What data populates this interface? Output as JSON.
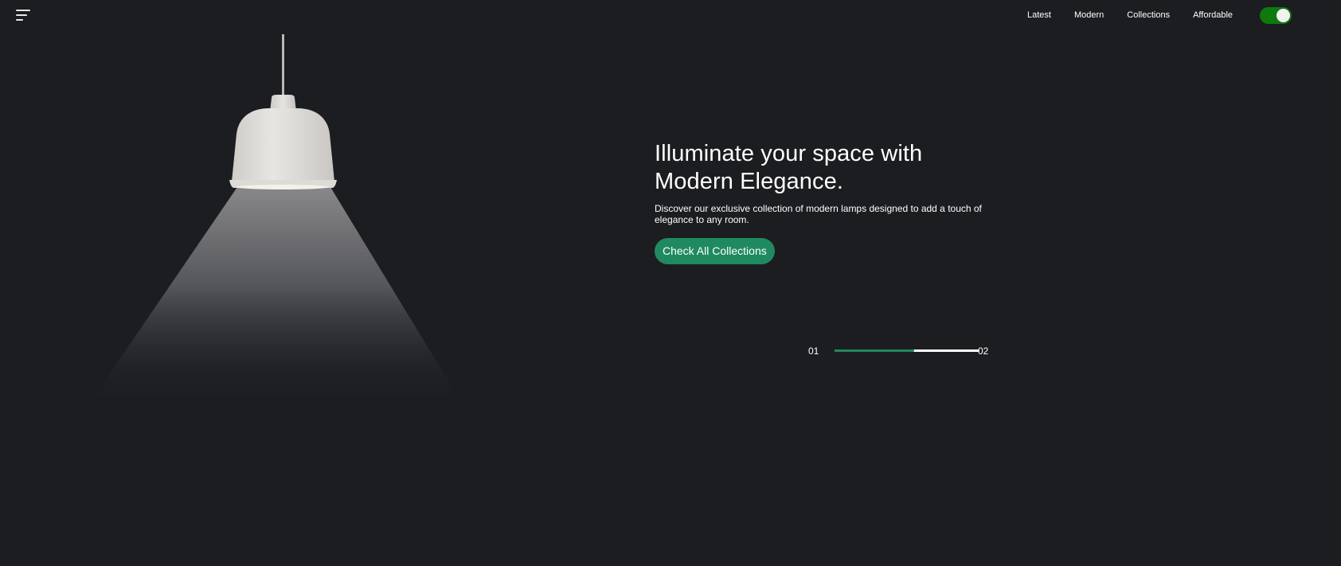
{
  "header": {
    "menu_icon": "hamburger-menu-icon",
    "nav_items": [
      "Latest",
      "Modern",
      "Collections",
      "Affordable"
    ],
    "theme_toggle": {
      "state": "on",
      "color": "#0e7a0e"
    }
  },
  "hero": {
    "title_line1": "Illuminate your space with",
    "title_line2": "Modern Elegance.",
    "description": "Discover our exclusive collection of modern lamps designed to add a touch of elegance to any room.",
    "cta_label": "Check All Collections",
    "cta_color": "#1f8a5f"
  },
  "slider": {
    "current": "01",
    "total": "02",
    "progress": 0.55,
    "progress_color": "#23875b"
  },
  "colors": {
    "background": "#1c1d21",
    "lamp_shade": "#e4e2df"
  }
}
